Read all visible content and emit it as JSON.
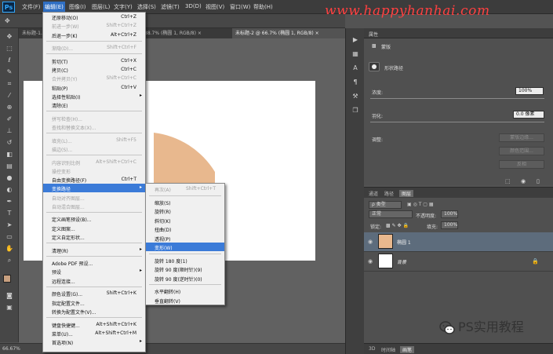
{
  "app": {
    "logo": "Ps"
  },
  "menubar": {
    "items": [
      "文件(F)",
      "编辑(E)",
      "图像(I)",
      "图层(L)",
      "文字(Y)",
      "选择(S)",
      "滤镜(T)",
      "3D(D)",
      "视图(V)",
      "窗口(W)",
      "帮助(H)"
    ],
    "active_index": 1
  },
  "watermark": "www.happyhanhai.com",
  "tabs": [
    {
      "label": "未标题-1.psd @ 66.7% (…",
      "active": false
    },
    {
      "label": "…88.7% (椭圆 1, RGB/8) ×",
      "active": false
    },
    {
      "label": "未标题-2 @ 66.7% (椭圆 1, RGB/8) ×",
      "active": true
    }
  ],
  "status": {
    "zoom": "66.67%"
  },
  "canvas": {
    "shape_color": "#e8b88e"
  },
  "edit_menu": {
    "items": [
      {
        "label": "还原移动(O)",
        "shortcut": "Ctrl+Z",
        "enabled": true,
        "submenu": false
      },
      {
        "label": "前进一步(W)",
        "shortcut": "Shift+Ctrl+Z",
        "enabled": false,
        "submenu": false
      },
      {
        "label": "后退一步(K)",
        "shortcut": "Alt+Ctrl+Z",
        "enabled": true,
        "submenu": false
      },
      {
        "sep": true
      },
      {
        "label": "渐隐(D)...",
        "shortcut": "Shift+Ctrl+F",
        "enabled": false,
        "submenu": false
      },
      {
        "sep": true
      },
      {
        "label": "剪切(T)",
        "shortcut": "Ctrl+X",
        "enabled": true,
        "submenu": false
      },
      {
        "label": "拷贝(C)",
        "shortcut": "Ctrl+C",
        "enabled": true,
        "submenu": false
      },
      {
        "label": "合并拷贝(Y)",
        "shortcut": "Shift+Ctrl+C",
        "enabled": false,
        "submenu": false
      },
      {
        "label": "粘贴(P)",
        "shortcut": "Ctrl+V",
        "enabled": true,
        "submenu": false
      },
      {
        "label": "选择性粘贴(I)",
        "shortcut": "",
        "enabled": true,
        "submenu": true
      },
      {
        "label": "清除(E)",
        "shortcut": "",
        "enabled": true,
        "submenu": false
      },
      {
        "sep": true
      },
      {
        "label": "拼写检查(H)...",
        "shortcut": "",
        "enabled": false,
        "submenu": false
      },
      {
        "label": "查找和替换文本(X)...",
        "shortcut": "",
        "enabled": false,
        "submenu": false
      },
      {
        "sep": true
      },
      {
        "label": "填充(L)...",
        "shortcut": "Shift+F5",
        "enabled": false,
        "submenu": false
      },
      {
        "label": "描边(S)...",
        "shortcut": "",
        "enabled": false,
        "submenu": false
      },
      {
        "sep": true
      },
      {
        "label": "内容识别比例",
        "shortcut": "Alt+Shift+Ctrl+C",
        "enabled": false,
        "submenu": false
      },
      {
        "label": "操控变形",
        "shortcut": "",
        "enabled": false,
        "submenu": false
      },
      {
        "label": "自由变换路径(F)",
        "shortcut": "Ctrl+T",
        "enabled": true,
        "submenu": false
      },
      {
        "label": "变换路径",
        "shortcut": "",
        "enabled": true,
        "submenu": true,
        "highlighted": true
      },
      {
        "label": "自动对齐图层...",
        "shortcut": "",
        "enabled": false,
        "submenu": false
      },
      {
        "label": "自动混合图层...",
        "shortcut": "",
        "enabled": false,
        "submenu": false
      },
      {
        "sep": true
      },
      {
        "label": "定义画笔预设(B)...",
        "shortcut": "",
        "enabled": true,
        "submenu": false
      },
      {
        "label": "定义图案...",
        "shortcut": "",
        "enabled": true,
        "submenu": false
      },
      {
        "label": "定义自定形状...",
        "shortcut": "",
        "enabled": true,
        "submenu": false
      },
      {
        "sep": true
      },
      {
        "label": "清理(R)",
        "shortcut": "",
        "enabled": true,
        "submenu": true
      },
      {
        "sep": true
      },
      {
        "label": "Adobe PDF 预设...",
        "shortcut": "",
        "enabled": true,
        "submenu": false
      },
      {
        "label": "预设",
        "shortcut": "",
        "enabled": true,
        "submenu": true
      },
      {
        "label": "远程连接...",
        "shortcut": "",
        "enabled": true,
        "submenu": false
      },
      {
        "sep": true
      },
      {
        "label": "颜色设置(G)...",
        "shortcut": "Shift+Ctrl+K",
        "enabled": true,
        "submenu": false
      },
      {
        "label": "指定配置文件...",
        "shortcut": "",
        "enabled": true,
        "submenu": false
      },
      {
        "label": "转换为配置文件(V)...",
        "shortcut": "",
        "enabled": true,
        "submenu": false
      },
      {
        "sep": true
      },
      {
        "label": "键盘快捷键...",
        "shortcut": "Alt+Shift+Ctrl+K",
        "enabled": true,
        "submenu": false
      },
      {
        "label": "菜单(U)...",
        "shortcut": "Alt+Shift+Ctrl+M",
        "enabled": true,
        "submenu": false
      },
      {
        "label": "首选项(N)",
        "shortcut": "",
        "enabled": true,
        "submenu": true
      }
    ]
  },
  "transform_submenu": {
    "items": [
      {
        "label": "再次(A)",
        "shortcut": "Shift+Ctrl+T",
        "enabled": false
      },
      {
        "sep": true
      },
      {
        "label": "缩放(S)",
        "shortcut": "",
        "enabled": true
      },
      {
        "label": "旋转(R)",
        "shortcut": "",
        "enabled": true
      },
      {
        "label": "斜切(K)",
        "shortcut": "",
        "enabled": true
      },
      {
        "label": "扭曲(D)",
        "shortcut": "",
        "enabled": true
      },
      {
        "label": "透视(P)",
        "shortcut": "",
        "enabled": true
      },
      {
        "label": "变形(W)",
        "shortcut": "",
        "enabled": true,
        "highlighted": true
      },
      {
        "sep": true
      },
      {
        "label": "旋转 180 度(1)",
        "shortcut": "",
        "enabled": true
      },
      {
        "label": "旋转 90 度(顺时针)(9)",
        "shortcut": "",
        "enabled": true
      },
      {
        "label": "旋转 90 度(逆时针)(0)",
        "shortcut": "",
        "enabled": true
      },
      {
        "sep": true
      },
      {
        "label": "水平翻转(H)",
        "shortcut": "",
        "enabled": true
      },
      {
        "label": "垂直翻转(V)",
        "shortcut": "",
        "enabled": true
      }
    ]
  },
  "properties": {
    "title": "属性",
    "subtitle": "蒙版",
    "shape_label": "形状路径",
    "density_label": "浓度:",
    "density_value": "100%",
    "feather_label": "羽化:",
    "feather_value": "0.0 像素",
    "adjust_label": "调整:",
    "buttons": [
      "蒙版边缘...",
      "颜色范围...",
      "反相"
    ]
  },
  "layers": {
    "tabs": [
      "通道",
      "路径",
      "图层"
    ],
    "active_tab": 2,
    "filter_label": "ρ 类型",
    "blend_mode": "正常",
    "opacity_label": "不透明度:",
    "opacity_value": "100%",
    "lock_label": "锁定:",
    "fill_label": "填充:",
    "fill_value": "100%",
    "rows": [
      {
        "name": "椭圆 1",
        "selected": true,
        "thumb_color": "#e8b88e"
      },
      {
        "name": "背景",
        "selected": false,
        "thumb_color": "#ffffff"
      }
    ],
    "footer_tabs": [
      "3D",
      "时间轴",
      "画笔"
    ]
  },
  "wechat_caption": "PS实用教程"
}
